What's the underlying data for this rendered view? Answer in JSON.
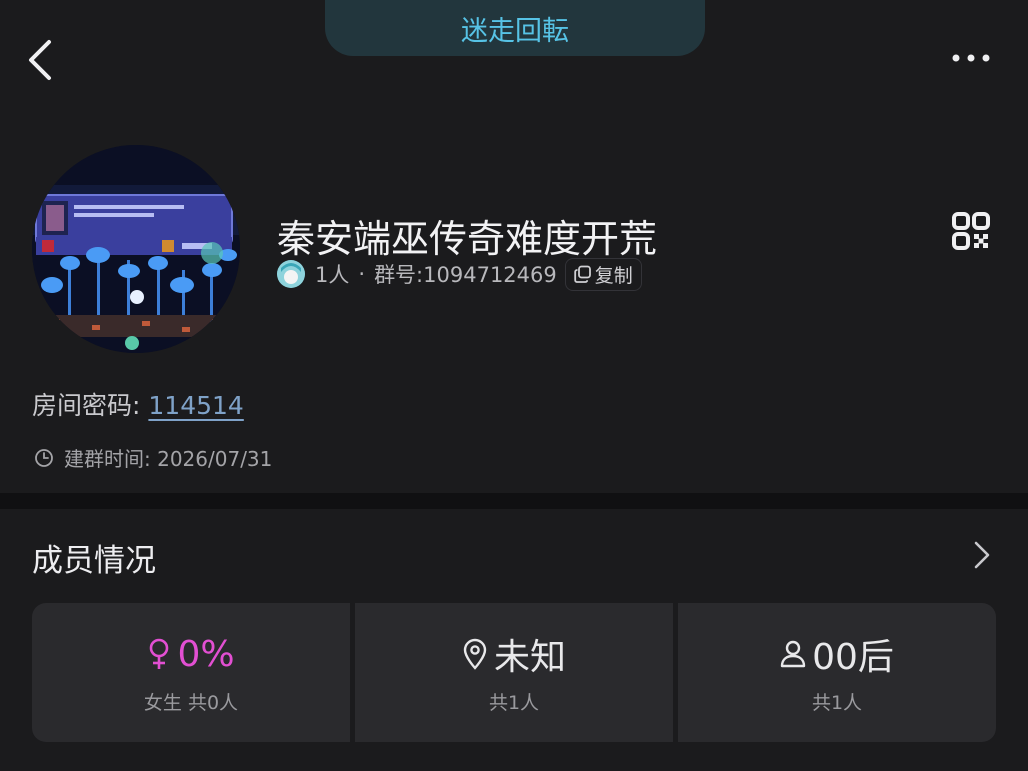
{
  "header": {
    "pill_label": "迷走回転",
    "back_icon": "chevron-left-icon",
    "more_icon": "more-horizontal-icon"
  },
  "group": {
    "name": "秦安端巫传奇难度开荒",
    "members": "1人",
    "separator": "·",
    "group_number": "群号:1094712469",
    "copy_label": "复制",
    "qr_icon": "qr-code-icon"
  },
  "room": {
    "password_label": "房间密码:",
    "password_value": "114514",
    "created_label": "建群时间:",
    "created_value": "2026/07/31"
  },
  "members_section": {
    "title": "成员情况",
    "stats": [
      {
        "icon": "female-icon",
        "value": "0%",
        "sub": "女生 共0人",
        "color": "#e24fd2"
      },
      {
        "icon": "location-pin-icon",
        "value": "未知",
        "sub": "共1人",
        "color": "#e8e8ea"
      },
      {
        "icon": "person-icon",
        "value": "00后",
        "sub": "共1人",
        "color": "#e8e8ea"
      }
    ]
  }
}
